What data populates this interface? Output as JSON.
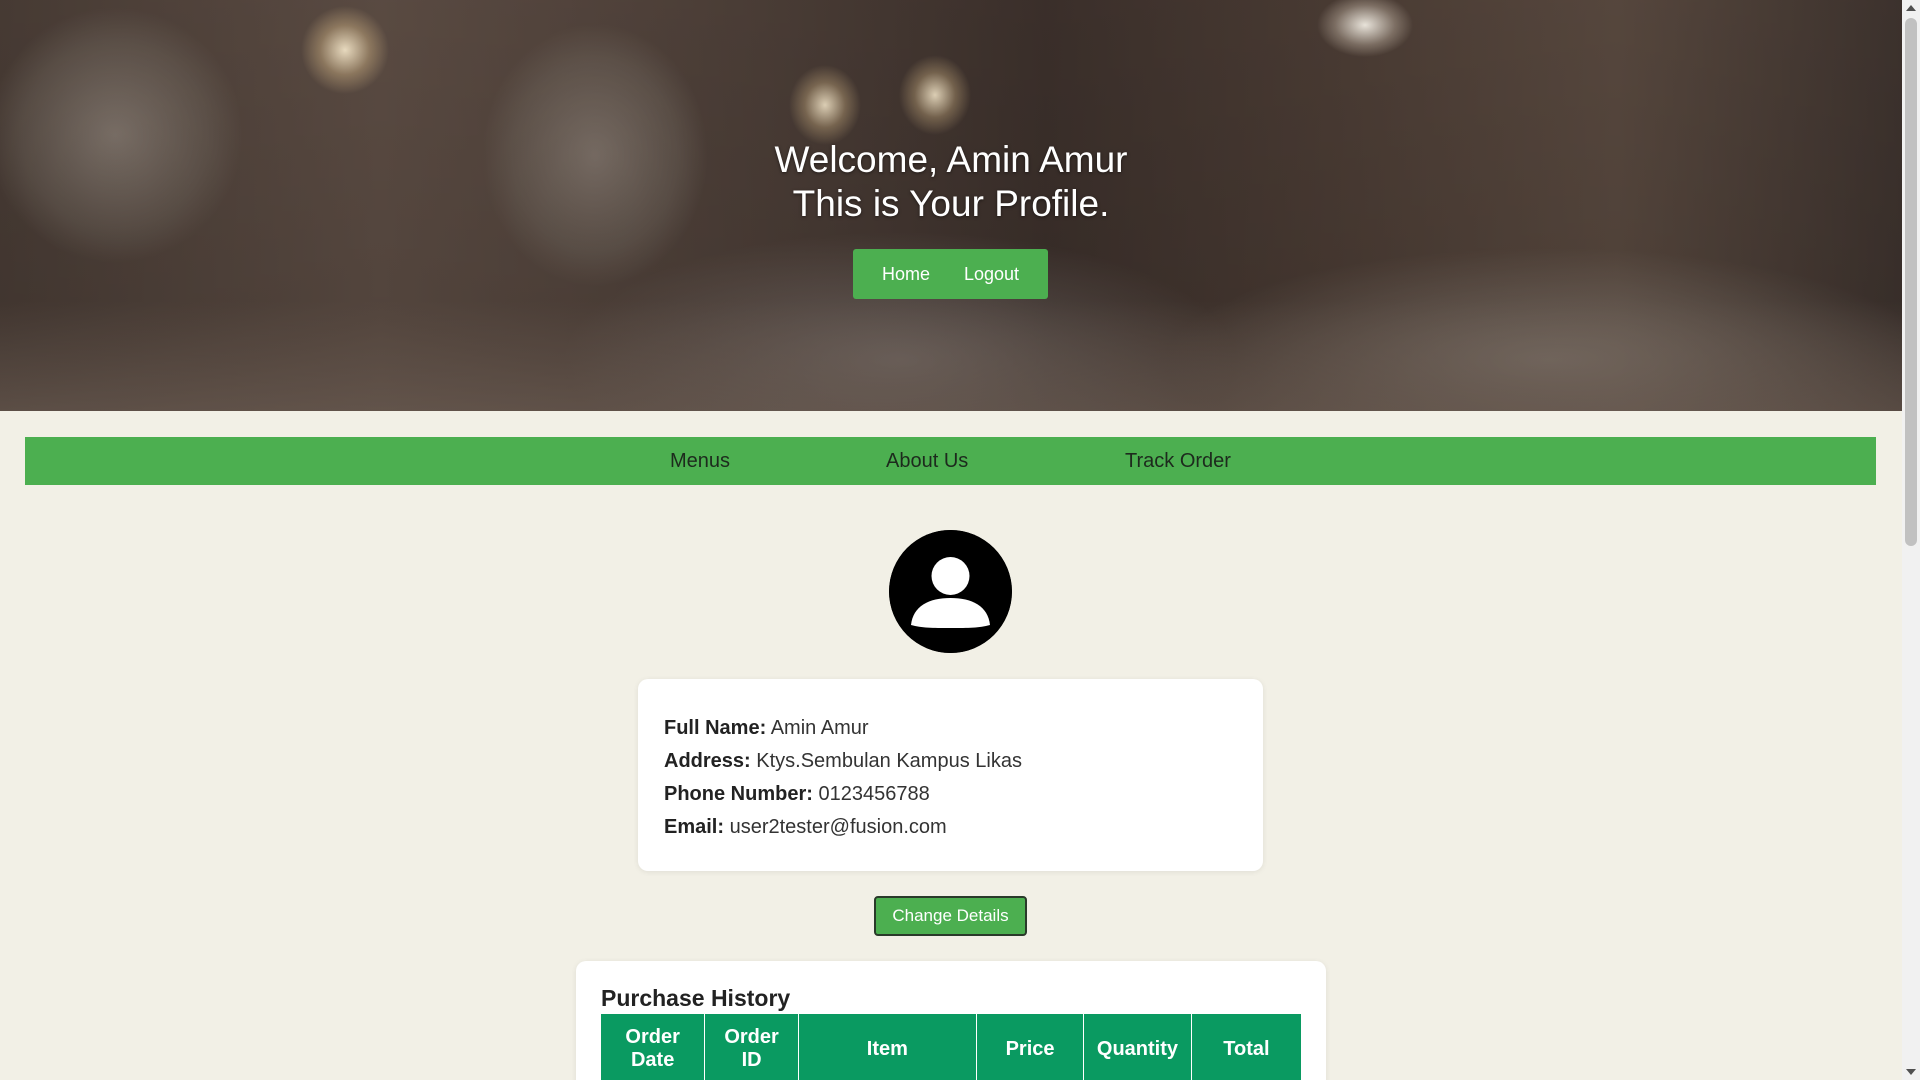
{
  "hero": {
    "title_line1": "Welcome, Amin Amur",
    "title_line2": "This is Your Profile.",
    "nav": {
      "home_label": "Home",
      "logout_label": "Logout"
    }
  },
  "main_nav": {
    "items": [
      {
        "label": "Menus"
      },
      {
        "label": "About Us"
      },
      {
        "label": "Track Order"
      }
    ]
  },
  "profile": {
    "avatar_icon": "user-avatar-icon",
    "fields": [
      {
        "label": "Full Name:",
        "value": "Amin Amur"
      },
      {
        "label": "Address:",
        "value": "Ktys.Sembulan Kampus Likas"
      },
      {
        "label": "Phone Number:",
        "value": "0123456788"
      },
      {
        "label": "Email:",
        "value": "user2tester@fusion.com"
      }
    ],
    "change_button_label": "Change Details"
  },
  "history": {
    "title": "Purchase History",
    "columns": [
      {
        "line1": "Order",
        "line2": "Date"
      },
      {
        "line1": "Order",
        "line2": "ID"
      },
      {
        "line1": "Item",
        "line2": ""
      },
      {
        "line1": "Price",
        "line2": ""
      },
      {
        "line1": "Quantity",
        "line2": ""
      },
      {
        "line1": "Total",
        "line2": ""
      }
    ]
  },
  "colors": {
    "accent_green": "#4caf50",
    "table_header_green": "#0a9a61",
    "page_background": "#f2f0e6"
  }
}
